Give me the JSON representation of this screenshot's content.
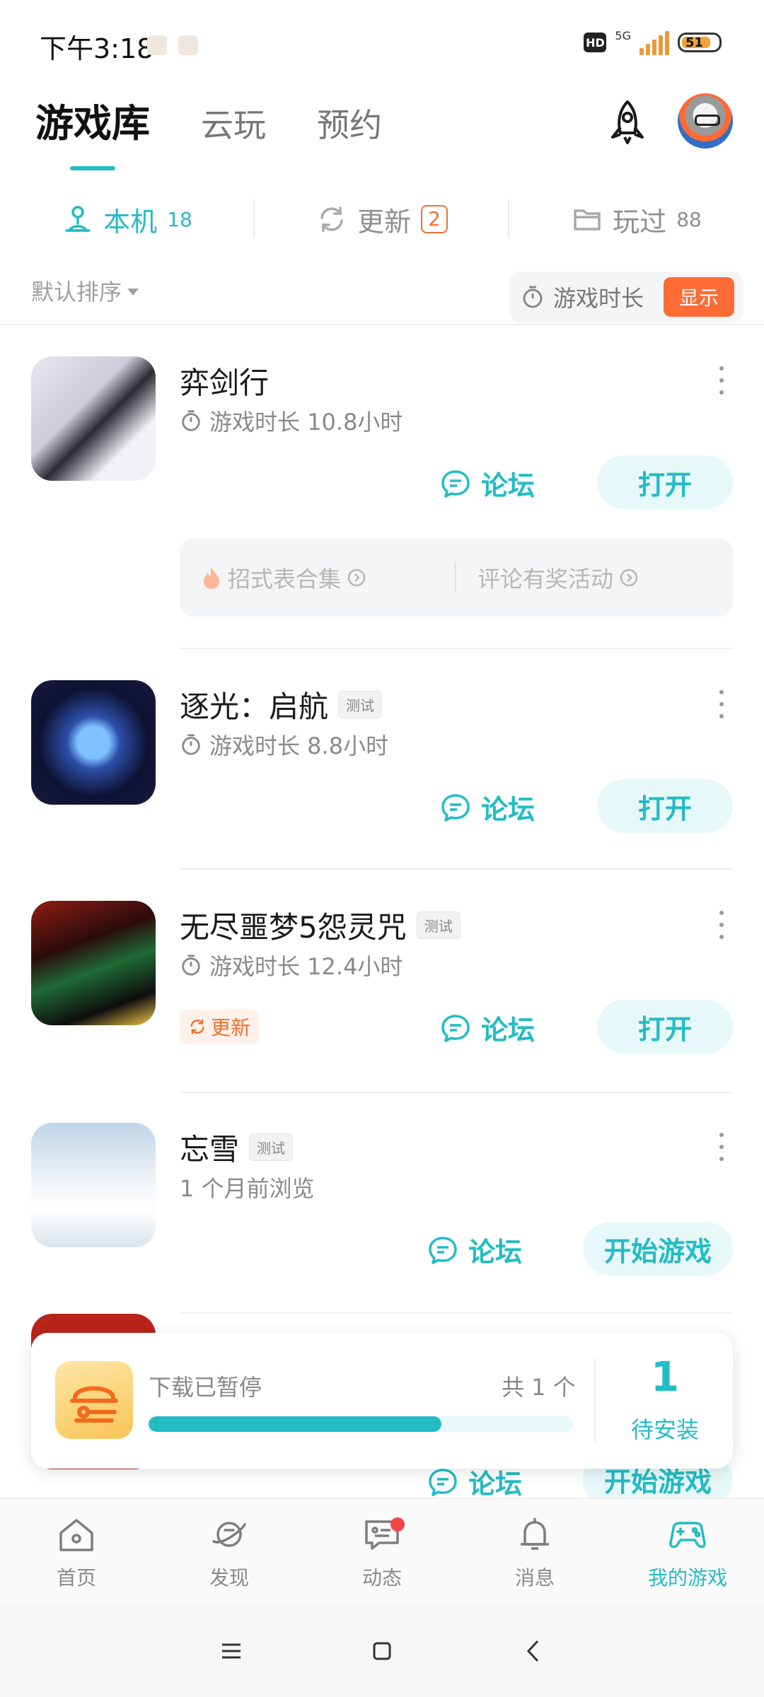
{
  "status_bar": {
    "time": "下午3:18",
    "hd": "HD",
    "network": "5G",
    "battery": "51"
  },
  "header": {
    "tabs": [
      {
        "label": "游戏库"
      },
      {
        "label": "云玩"
      },
      {
        "label": "预约"
      }
    ]
  },
  "sub_tabs": [
    {
      "label": "本机",
      "count": "18"
    },
    {
      "label": "更新",
      "count": "2"
    },
    {
      "label": "玩过",
      "count": "88"
    }
  ],
  "sort": {
    "label": "默认排序"
  },
  "duration_toggle": {
    "label": "游戏时长",
    "button": "显示"
  },
  "games": [
    {
      "name": "弈剑行",
      "meta": "游戏时长 10.8小时",
      "forum": "论坛",
      "action": "打开",
      "promos": [
        "招式表合集",
        "评论有奖活动"
      ]
    },
    {
      "name": "逐光：启航",
      "badge": "测试",
      "meta": "游戏时长 8.8小时",
      "forum": "论坛",
      "action": "打开"
    },
    {
      "name": "无尽噩梦5怨灵咒",
      "badge": "测试",
      "meta": "游戏时长 12.4小时",
      "update": "更新",
      "forum": "论坛",
      "action": "打开"
    },
    {
      "name": "忘雪",
      "badge": "测试",
      "meta": "1 个月前浏览",
      "forum": "论坛",
      "action": "开始游戏"
    },
    {
      "forum": "论坛",
      "action": "开始游戏"
    }
  ],
  "download": {
    "status": "下载已暂停",
    "total": "共 1 个",
    "progress": 0.69,
    "pending_count": "1",
    "pending_label": "待安装"
  },
  "bottom_nav": [
    {
      "label": "首页"
    },
    {
      "label": "发现"
    },
    {
      "label": "动态"
    },
    {
      "label": "消息"
    },
    {
      "label": "我的游戏"
    }
  ],
  "colors": {
    "accent": "#23bcc4",
    "orange": "#ff6b35"
  }
}
